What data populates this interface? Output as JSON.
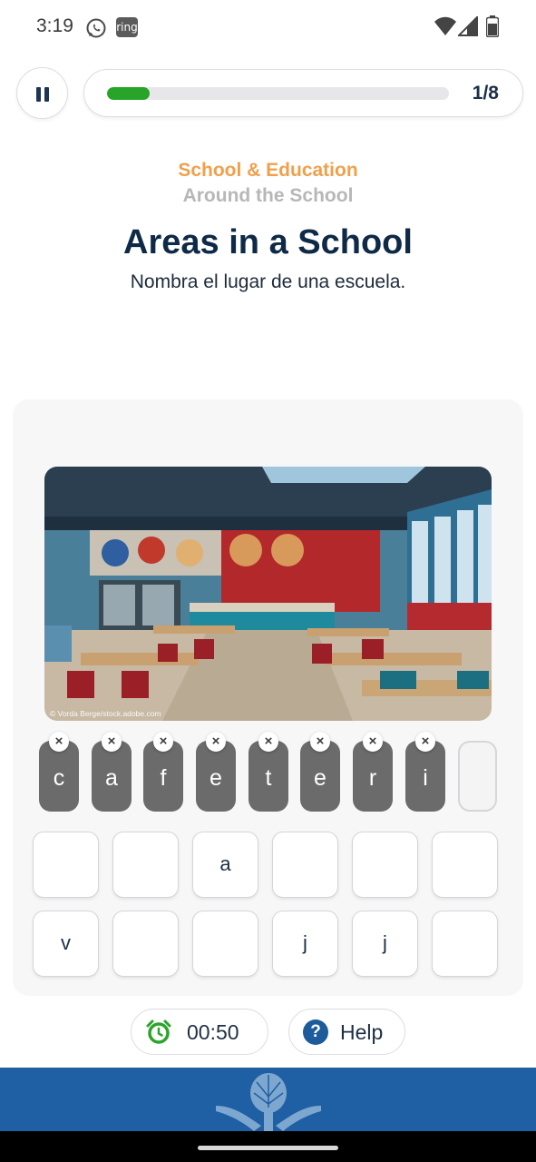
{
  "status_bar": {
    "time": "3:19",
    "icons": [
      "whatsapp-icon",
      "ring-app-icon",
      "wifi-icon",
      "cell-signal-icon",
      "battery-icon"
    ],
    "ring_label": "ring"
  },
  "progress": {
    "current": 1,
    "total": 8,
    "label": "1/8",
    "fill_fraction": 0.125
  },
  "category": "School & Education",
  "subcategory": "Around the School",
  "title": "Areas in a School",
  "instruction": "Nombra el lugar de una escuela.",
  "image": {
    "description_icon": "school-cafeteria-photo",
    "credit": "© Vorda Berge/stock.adobe.com"
  },
  "answer": {
    "letters": [
      "c",
      "a",
      "f",
      "e",
      "t",
      "e",
      "r",
      "i"
    ],
    "remove_glyph": "×",
    "empty_slots": 1
  },
  "keyboard": {
    "row1": [
      "",
      "",
      "a",
      "",
      "",
      ""
    ],
    "row2": [
      "v",
      "",
      "",
      "j",
      "j",
      ""
    ]
  },
  "timer": {
    "value": "00:50",
    "icon": "alarm-clock-icon"
  },
  "help": {
    "label": "Help",
    "icon_glyph": "?"
  },
  "colors": {
    "accent_orange": "#f0a04b",
    "progress_green": "#28a428",
    "title_navy": "#0f2a47",
    "banner_blue": "#1f5fa3",
    "tile_gray": "#6b6b6b",
    "timer_green": "#2aa52a"
  }
}
